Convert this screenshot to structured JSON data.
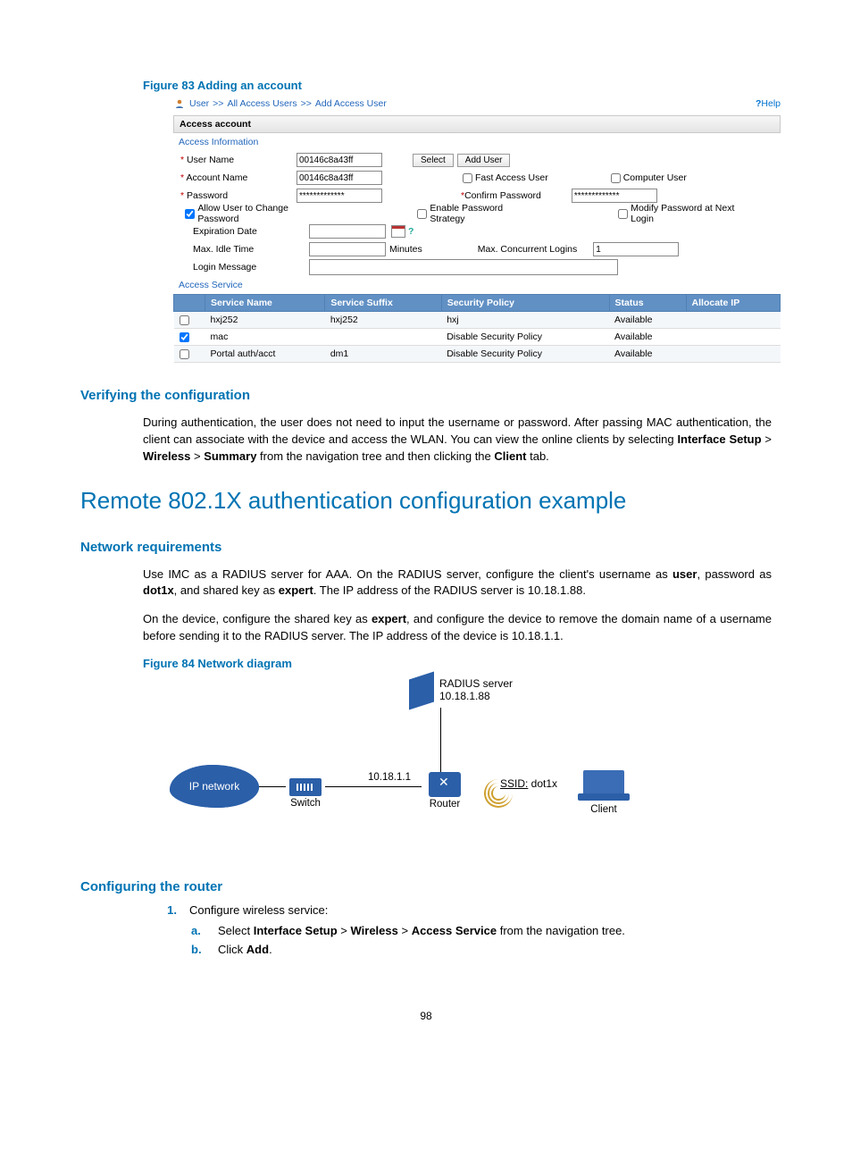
{
  "figure83_caption": "Figure 83 Adding an account",
  "breadcrumb": {
    "l1": "User",
    "l2": "All Access Users",
    "l3": "Add Access User",
    "sep": ">>",
    "help": "Help"
  },
  "panel": "Access account",
  "section_info": "Access Information",
  "labels": {
    "username": "User Name",
    "accountname": "Account Name",
    "password": "Password",
    "confirm": "Confirm Password",
    "allow_change": "Allow User to Change Password",
    "enable_strategy": "Enable Password Strategy",
    "modify_next": "Modify Password at Next Login",
    "expiration": "Expiration Date",
    "maxidle": "Max. Idle Time",
    "minutes": "Minutes",
    "maxconc": "Max. Concurrent Logins",
    "loginmsg": "Login Message",
    "fastuser": "Fast Access User",
    "compuser": "Computer User",
    "select": "Select",
    "adduser": "Add User"
  },
  "values": {
    "username": "00146c8a43ff",
    "accountname": "00146c8a43ff",
    "password": "*************",
    "confirm": "*************",
    "maxconc": "1"
  },
  "section_svc": "Access Service",
  "svc_headers": [
    "Service Name",
    "Service Suffix",
    "Security Policy",
    "Status",
    "Allocate IP"
  ],
  "svc_rows": [
    {
      "checked": false,
      "name": "hxj252",
      "suffix": "hxj252",
      "policy": "hxj",
      "status": "Available",
      "ip": ""
    },
    {
      "checked": true,
      "name": "mac",
      "suffix": "",
      "policy": "Disable Security Policy",
      "status": "Available",
      "ip": ""
    },
    {
      "checked": false,
      "name": "Portal auth/acct",
      "suffix": "dm1",
      "policy": "Disable Security Policy",
      "status": "Available",
      "ip": ""
    }
  ],
  "h3_verify": "Verifying the configuration",
  "p_verify_1": "During authentication, the user does not need to input the username or password. After passing MAC authentication, the client can associate with the device and access the WLAN. You can view the online clients by selecting ",
  "p_verify_b1": "Interface Setup",
  "p_verify_gt": " > ",
  "p_verify_b2": "Wireless",
  "p_verify_b3": "Summary",
  "p_verify_2": " from the navigation tree and then clicking the ",
  "p_verify_b4": "Client",
  "p_verify_3": " tab.",
  "h2": "Remote 802.1X authentication configuration example",
  "h3_net": "Network requirements",
  "p_net_1": "Use IMC as a RADIUS server for AAA. On the RADIUS server, configure the client's username as ",
  "p_net_b1": "user",
  "p_net_2": ", password as ",
  "p_net_b2": "dot1x",
  "p_net_3": ", and shared key as ",
  "p_net_b3": "expert",
  "p_net_4": ". The IP address of the RADIUS server is 10.18.1.88.",
  "p_net2_1": "On the device, configure the shared key as ",
  "p_net2_b1": "expert",
  "p_net2_2": ", and configure the device to remove the domain name of a username before sending it to the RADIUS server. The IP address of the device is 10.18.1.1.",
  "figure84_caption": "Figure 84 Network diagram",
  "diagram": {
    "ipnet": "IP network",
    "switch": "Switch",
    "router": "Router",
    "client": "Client",
    "radius_l1": "RADIUS server",
    "radius_l2": "10.18.1.88",
    "ip": "10.18.1.1",
    "ssid_pre": "SSID:",
    "ssid_val": " dot1x"
  },
  "h3_router": "Configuring the router",
  "step1": "Configure wireless service:",
  "step1a_1": "Select ",
  "step1a_b1": "Interface Setup",
  "step1a_b2": "Wireless",
  "step1a_b3": "Access Service",
  "step1a_2": " from the navigation tree.",
  "step1b_1": "Click ",
  "step1b_b1": "Add",
  "step1b_2": ".",
  "pagenum": "98"
}
